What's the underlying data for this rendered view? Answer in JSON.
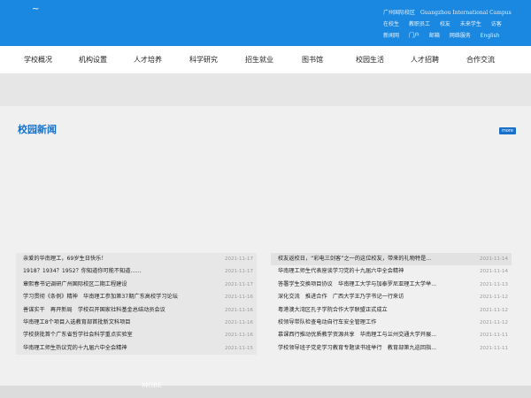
{
  "header": {
    "logo_text": "~",
    "campus_cn": "广州国际校区",
    "campus_en": "Guangzhou International Campus",
    "links_row1": [
      "在校生",
      "教职员工",
      "校友",
      "未来学生",
      "访客"
    ],
    "links_row2": [
      "新闻网",
      "门户",
      "邮箱",
      "网络服务",
      "English"
    ]
  },
  "nav": {
    "items": [
      "学校概况",
      "机构设置",
      "人才培养",
      "科学研究",
      "招生就业",
      "图书馆",
      "校园生活",
      "人才招聘",
      "合作交流"
    ]
  },
  "section": {
    "title": "校园新闻",
    "more_badge": "more",
    "more_link": "MORE"
  },
  "colors": {
    "header_bg": "#1a88e0",
    "accent": "#1a70c8"
  },
  "news_left": [
    {
      "title": "亲爱的华南理工，69岁生日快乐！",
      "date": "2021-11-17"
    },
    {
      "title": "1918？1934？1952？你知道你可能不知道……",
      "date": "2021-11-17"
    },
    {
      "title": "章熙春书记调研广州国际校区二期工程建设",
      "date": "2021-11-17"
    },
    {
      "title": "学习贯彻《条例》精神　华南理工参加第37期广东高校学习论坛",
      "date": "2021-11-16"
    },
    {
      "title": "善谋实干　再开新局　学校召开国家社科基金总结动员会议",
      "date": "2021-11-16"
    },
    {
      "title": "华南理工8个项目入选教育部首批新文科项目",
      "date": "2021-11-16"
    },
    {
      "title": "学校获批首个广东省哲学社会科学重点实验室",
      "date": "2021-11-16"
    },
    {
      "title": "华南理工师生热议党的十九届六中全会精神",
      "date": "2021-11-15"
    }
  ],
  "news_right": [
    {
      "title": "校友返校日，“彩电三剑客”之一的这位校友，带来的礼物特是...",
      "date": "2021-11-14"
    },
    {
      "title": "华南理工师生代表座谈学习党的十九届六中全会精神",
      "date": "2021-11-14"
    },
    {
      "title": "答署学生交换项目协议　华南理工大学与加泰罗尼亚理工大学举...",
      "date": "2021-11-13"
    },
    {
      "title": "深化交流　推进合作　广西大学王乃学书记一行来访",
      "date": "2021-11-12"
    },
    {
      "title": "粤港澳大湾区孔子学院合作大学联盟正式成立",
      "date": "2021-11-12"
    },
    {
      "title": "校领导带队检查电动自行车安全管理工作",
      "date": "2021-11-12"
    },
    {
      "title": "慕课西行推动优质教学资源共享　华南理工与兰州交通大学开展...",
      "date": "2021-11-11"
    },
    {
      "title": "学校领导班子党史学习教育专题读书班举行　教育部第九巡回指...",
      "date": "2021-11-11"
    }
  ]
}
